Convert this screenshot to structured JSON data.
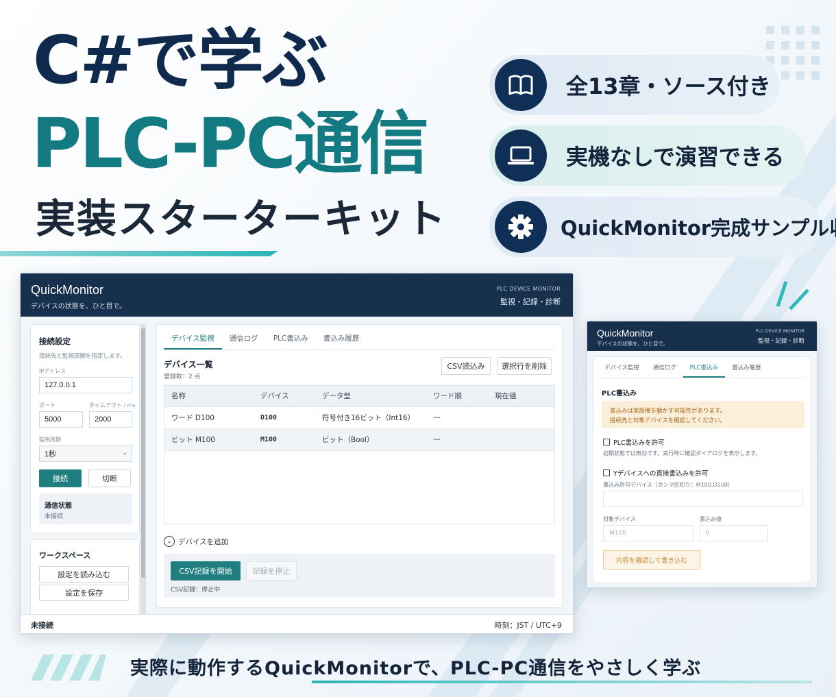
{
  "hero": {
    "line1": "C#で学ぶ",
    "line2": "PLC-PC通信",
    "line3": "実装スターターキット"
  },
  "features": [
    {
      "icon": "book-icon",
      "label": "全13章・ソース付き"
    },
    {
      "icon": "laptop-icon",
      "label": "実機なしで演習できる"
    },
    {
      "icon": "gear-icon",
      "label": "QuickMonitor完成サンプル収録"
    }
  ],
  "colors": {
    "navy": "#17304d",
    "teal": "#1f7f80",
    "hero_teal": "#127a80",
    "hero_navy": "#0f2a4d"
  },
  "main_window": {
    "title": "QuickMonitor",
    "subtitle": "デバイスの状態を、ひと目で。",
    "tag": "PLC DEVICE MONITOR",
    "tag2": "監視・記録・診断",
    "connection": {
      "heading": "接続設定",
      "desc": "接続先と監視周期を指定します。",
      "ip_label": "IPアドレス",
      "ip_value": "127.0.0.1",
      "port_label": "ポート",
      "port_value": "5000",
      "timeout_label": "タイムアウト / ms",
      "timeout_value": "2000",
      "cycle_label": "監視周期",
      "cycle_value": "1秒",
      "connect": "接続",
      "disconnect": "切断",
      "status_heading": "通信状態",
      "status_value": "未接続"
    },
    "workspace": {
      "heading": "ワークスペース",
      "load": "設定を読み込む",
      "save": "設定を保存"
    },
    "tabs": [
      "デバイス監視",
      "通信ログ",
      "PLC書込み",
      "書込み履歴"
    ],
    "devices": {
      "heading": "デバイス一覧",
      "count": "登録数：2 点",
      "csv_import": "CSV読込み",
      "delete_selected": "選択行を削除",
      "columns": [
        "名称",
        "デバイス",
        "データ型",
        "ワード順",
        "現在値"
      ],
      "rows": [
        [
          "ワード D100",
          "D100",
          "符号付き16ビット（Int16）",
          "—",
          ""
        ],
        [
          "ビット M100",
          "M100",
          "ビット（Bool）",
          "—",
          ""
        ]
      ],
      "add": "デバイスを追加"
    },
    "csv": {
      "start": "CSV記録を開始",
      "stop": "記録を停止",
      "status": "CSV記録：停止中"
    },
    "footer_left": "未接続",
    "footer_right": "時刻：JST / UTC+9"
  },
  "write_window": {
    "title": "QuickMonitor",
    "subtitle": "デバイスの状態を、ひと目で。",
    "tag": "PLC DEVICE MONITOR",
    "tag2": "監視・記録・診断",
    "tabs": [
      "デバイス監視",
      "通信ログ",
      "PLC書込み",
      "書込み履歴"
    ],
    "heading": "PLC書込み",
    "warning1": "書込みは実設備を動かす可能性があります。",
    "warning2": "接続先と対象デバイスを確認してください。",
    "allow_write": "PLC書込みを許可",
    "allow_write_desc": "初期状態では無効です。実行時に確認ダイアログを表示します。",
    "allow_y": "Yデバイスへの直接書込みを許可",
    "allowed_devices_label": "書込み許可デバイス（カンマ区切り：M100,D100）",
    "target_label": "対象デバイス",
    "target_placeholder": "M100",
    "value_label": "書込み値",
    "value_placeholder": "0",
    "confirm": "内容を確認して書き込む"
  },
  "caption": "実際に動作するQuickMonitorで、PLC-PC通信をやさしく学ぶ"
}
